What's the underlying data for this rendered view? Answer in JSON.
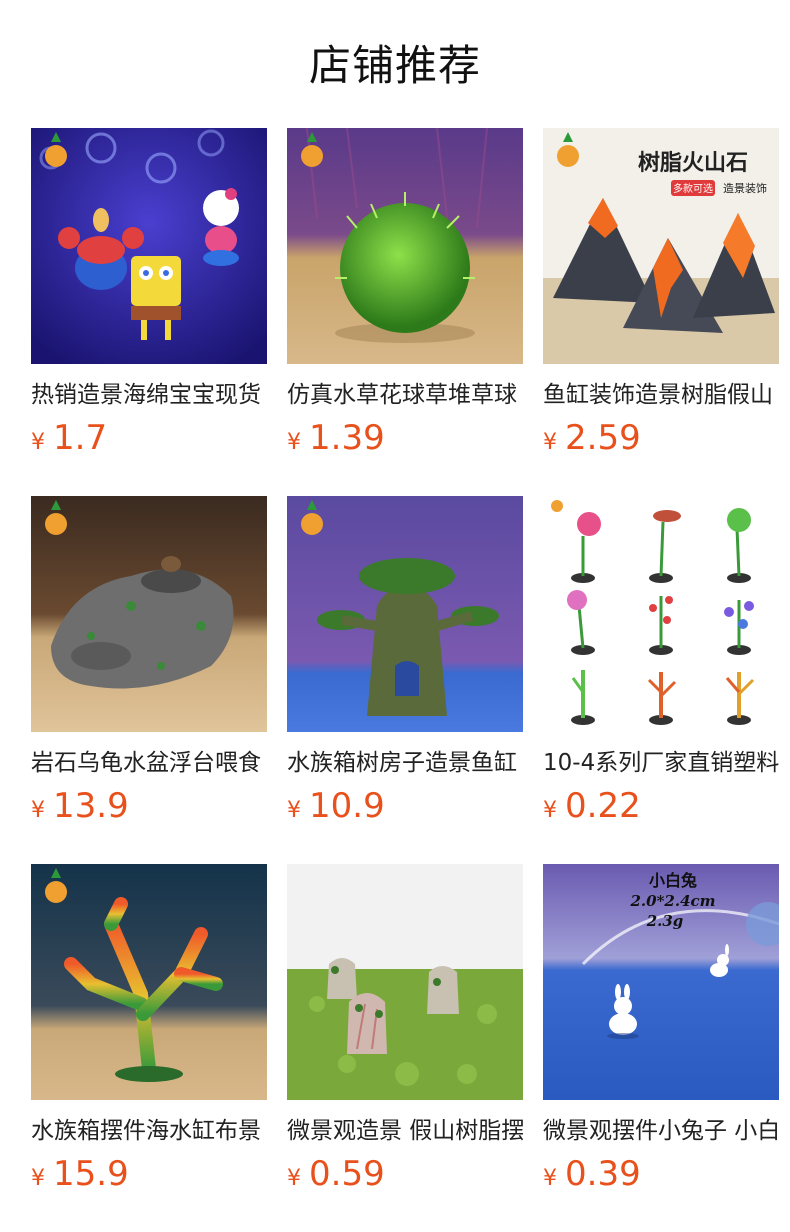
{
  "section": {
    "title": "店铺推荐"
  },
  "products": [
    {
      "name": "热销造景海绵宝宝现货",
      "currency": "¥",
      "price": "1.7",
      "image_icon": "cartoon-figures-image"
    },
    {
      "name": "仿真水草花球草堆草球",
      "currency": "¥",
      "price": "1.39",
      "image_icon": "grass-ball-image"
    },
    {
      "name": "鱼缸装饰造景树脂假山",
      "currency": "¥",
      "price": "2.59",
      "image_icon": "volcano-image",
      "image_text": {
        "headline": "树脂火山石",
        "tag": "多款可选",
        "sub": "造景装饰"
      }
    },
    {
      "name": "岩石乌龟水盆浮台喂食",
      "currency": "¥",
      "price": "13.9",
      "image_icon": "rock-basin-image"
    },
    {
      "name": "水族箱树房子造景鱼缸",
      "currency": "¥",
      "price": "10.9",
      "image_icon": "tree-house-image"
    },
    {
      "name": "10-4系列厂家直销塑料",
      "currency": "¥",
      "price": "0.22",
      "image_icon": "plastic-plants-image"
    },
    {
      "name": "水族箱摆件海水缸布景",
      "currency": "¥",
      "price": "15.9",
      "image_icon": "coral-image"
    },
    {
      "name": "微景观造景 假山树脂摆",
      "currency": "¥",
      "price": "0.59",
      "image_icon": "mini-rocks-image"
    },
    {
      "name": "微景观摆件小兔子 小白",
      "currency": "¥",
      "price": "0.39",
      "image_icon": "bunny-image",
      "image_text": {
        "line1": "小白兔",
        "line2": "2.0*2.4cm",
        "line3": "2.3g"
      }
    }
  ]
}
